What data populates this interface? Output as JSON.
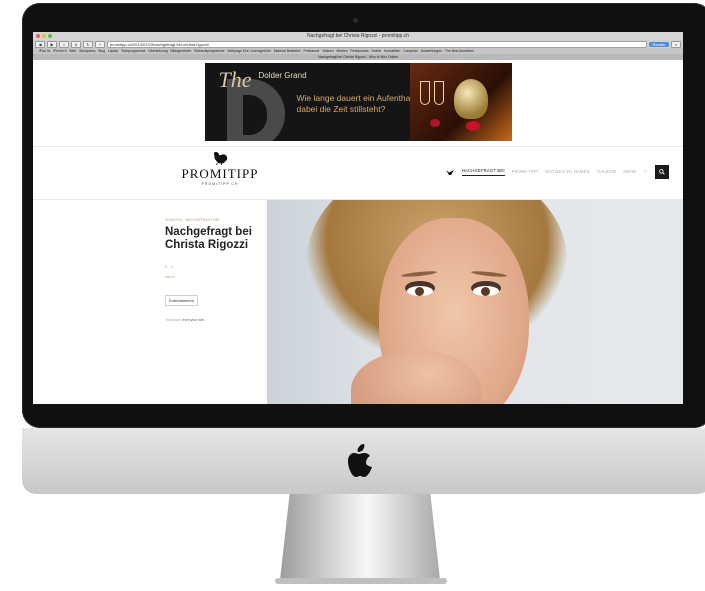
{
  "browser": {
    "window_title": "Nachgefragt bei Christa Rigozzi - promitipp.ch",
    "url": "promitipp.ch/2014/07/03/nachgefragt-bei-christa-rigozzi/",
    "reader_label": "Reader",
    "tab_title": "Nachgefragt bei Christa Rigozzi - Who is Who Online",
    "bookmarks": [
      "iPad 4s",
      "iPhone 6",
      "Web",
      "Wordpress",
      "Blog",
      "Laptop",
      "Techprogramme",
      "Übersetzung",
      "Bildagenturen",
      "Einkaufsprogramme",
      "Webpage Einr. Lizenzgebühr",
      "Material Bestellen",
      "Freelancer",
      "Wissen",
      "Medien",
      "Restaurants",
      "Hotels",
      "Immobilien",
      "Computer",
      "Ausstellungen",
      "The Best Ausleihen"
    ]
  },
  "ad": {
    "the": "The",
    "brand": "Dolder Grand",
    "copy": "Wie lange dauert ein Aufenthalt, wenn dabei die Zeit stillsteht?"
  },
  "site": {
    "logo_text": "PROMITIPP",
    "logo_sub": "PROMITIPP.CH",
    "nav": [
      "NACHGEFRAGT BEI",
      "PROMI-TIPP",
      "NOTIZEN ZU NAMEN",
      "GALERIE",
      "MEHR"
    ]
  },
  "post": {
    "meta": "31/05/2014 · NACHGEFRAGT BEI",
    "title": "Nachgefragt bei Christa Rigozzi",
    "counts": "0 · 1",
    "author": "brecht",
    "tag": "Entertainment",
    "trackback_link": "Trackback",
    "trackback_rest": " from your site."
  },
  "colors": {
    "accent": "#c4a989",
    "bezel": "#101010",
    "search_button": "#1a1a1a"
  }
}
